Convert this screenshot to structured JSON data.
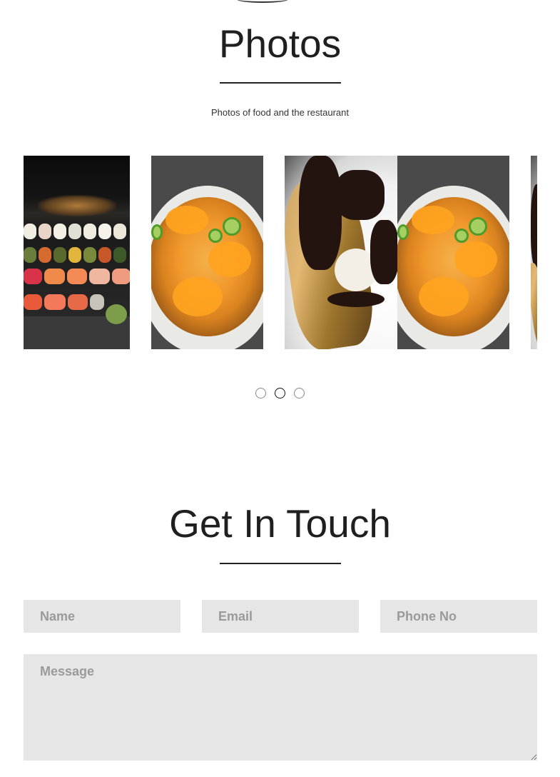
{
  "photos": {
    "title": "Photos",
    "subtitle": "Photos of food and the restaurant",
    "slides": [
      {
        "name": "sushi-photo",
        "alt": ""
      },
      {
        "name": "tempura-photo",
        "alt": ""
      },
      {
        "name": "crepe-photo",
        "alt": ""
      },
      {
        "name": "tempura-photo",
        "alt": ""
      },
      {
        "name": "crepe-photo",
        "alt": ""
      }
    ],
    "dots": {
      "count": 3,
      "active_index": 1
    }
  },
  "contact": {
    "title": "Get In Touch",
    "name_placeholder": "Name",
    "email_placeholder": "Email",
    "phone_placeholder": "Phone No",
    "message_placeholder": "Message"
  }
}
